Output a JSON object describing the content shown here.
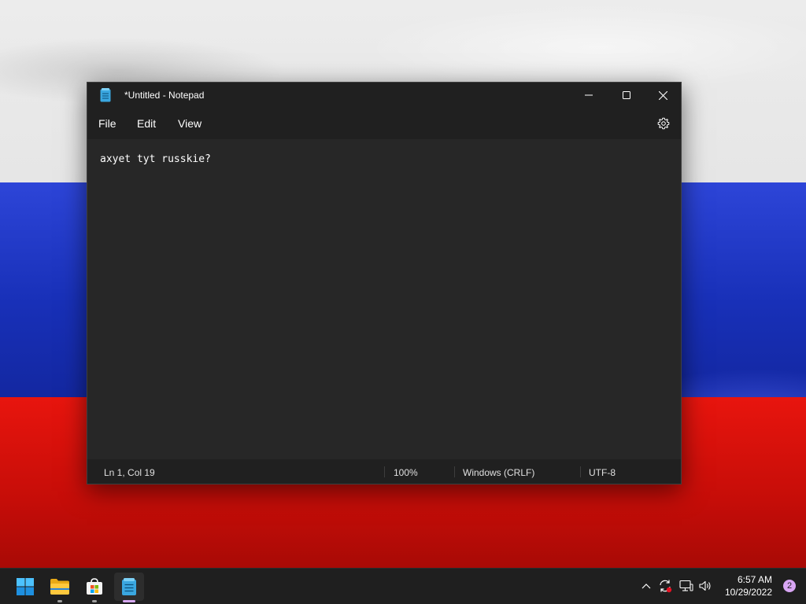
{
  "window": {
    "title": "*Untitled - Notepad",
    "menu": [
      "File",
      "Edit",
      "View"
    ],
    "content": "axyet tyt russkie?",
    "status": {
      "position": "Ln 1, Col 19",
      "zoom": "100%",
      "line_ending": "Windows (CRLF)",
      "encoding": "UTF-8"
    }
  },
  "taskbar": {
    "apps": [
      "start-icon",
      "file-explorer-icon",
      "microsoft-store-icon",
      "notepad-icon"
    ],
    "clock": {
      "time": "6:57 AM",
      "date": "10/29/2022"
    },
    "notification_count": "2"
  },
  "colors": {
    "window_bg": "#272727",
    "titlebar_bg": "#202020",
    "taskbar_bg": "#1f1f1f",
    "accent": "#d6a8f0",
    "flag_white": "#e6e6e6",
    "flag_blue": "#1f36c6",
    "flag_red": "#d5100a"
  }
}
